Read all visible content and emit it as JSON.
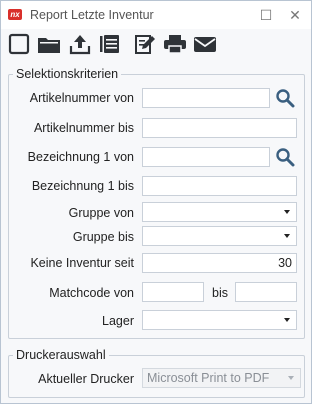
{
  "window": {
    "logo_text": "nx",
    "title": "Report Letzte Inventur",
    "maximize_glyph": "☐",
    "close_glyph": "✕"
  },
  "toolbar": {
    "buttons": [
      {
        "icon": "new-document-icon"
      },
      {
        "icon": "folder-icon"
      },
      {
        "icon": "export-icon"
      },
      {
        "icon": "list-icon"
      },
      {
        "icon": "edit-icon"
      },
      {
        "icon": "printer-icon"
      },
      {
        "icon": "mail-icon"
      }
    ]
  },
  "selection": {
    "legend": "Selektionskriterien",
    "artikel_von_label": "Artikelnummer von",
    "artikel_von_value": "",
    "artikel_bis_label": "Artikelnummer bis",
    "artikel_bis_value": "",
    "bezeichnung_von_label": "Bezeichnung 1 von",
    "bezeichnung_von_value": "",
    "bezeichnung_bis_label": "Bezeichnung 1 bis",
    "bezeichnung_bis_value": "",
    "gruppe_von_label": "Gruppe von",
    "gruppe_bis_label": "Gruppe bis",
    "keine_inventur_label": "Keine Inventur seit",
    "keine_inventur_value": "30",
    "matchcode_von_label": "Matchcode von",
    "matchcode_bis_label": "bis",
    "lager_label": "Lager"
  },
  "printer": {
    "legend": "Druckerauswahl",
    "label": "Aktueller Drucker",
    "value": "Microsoft Print to PDF"
  },
  "colors": {
    "accent_icon": "#2f3338",
    "search_icon": "#3a5f80",
    "logo": "#d9302b"
  }
}
